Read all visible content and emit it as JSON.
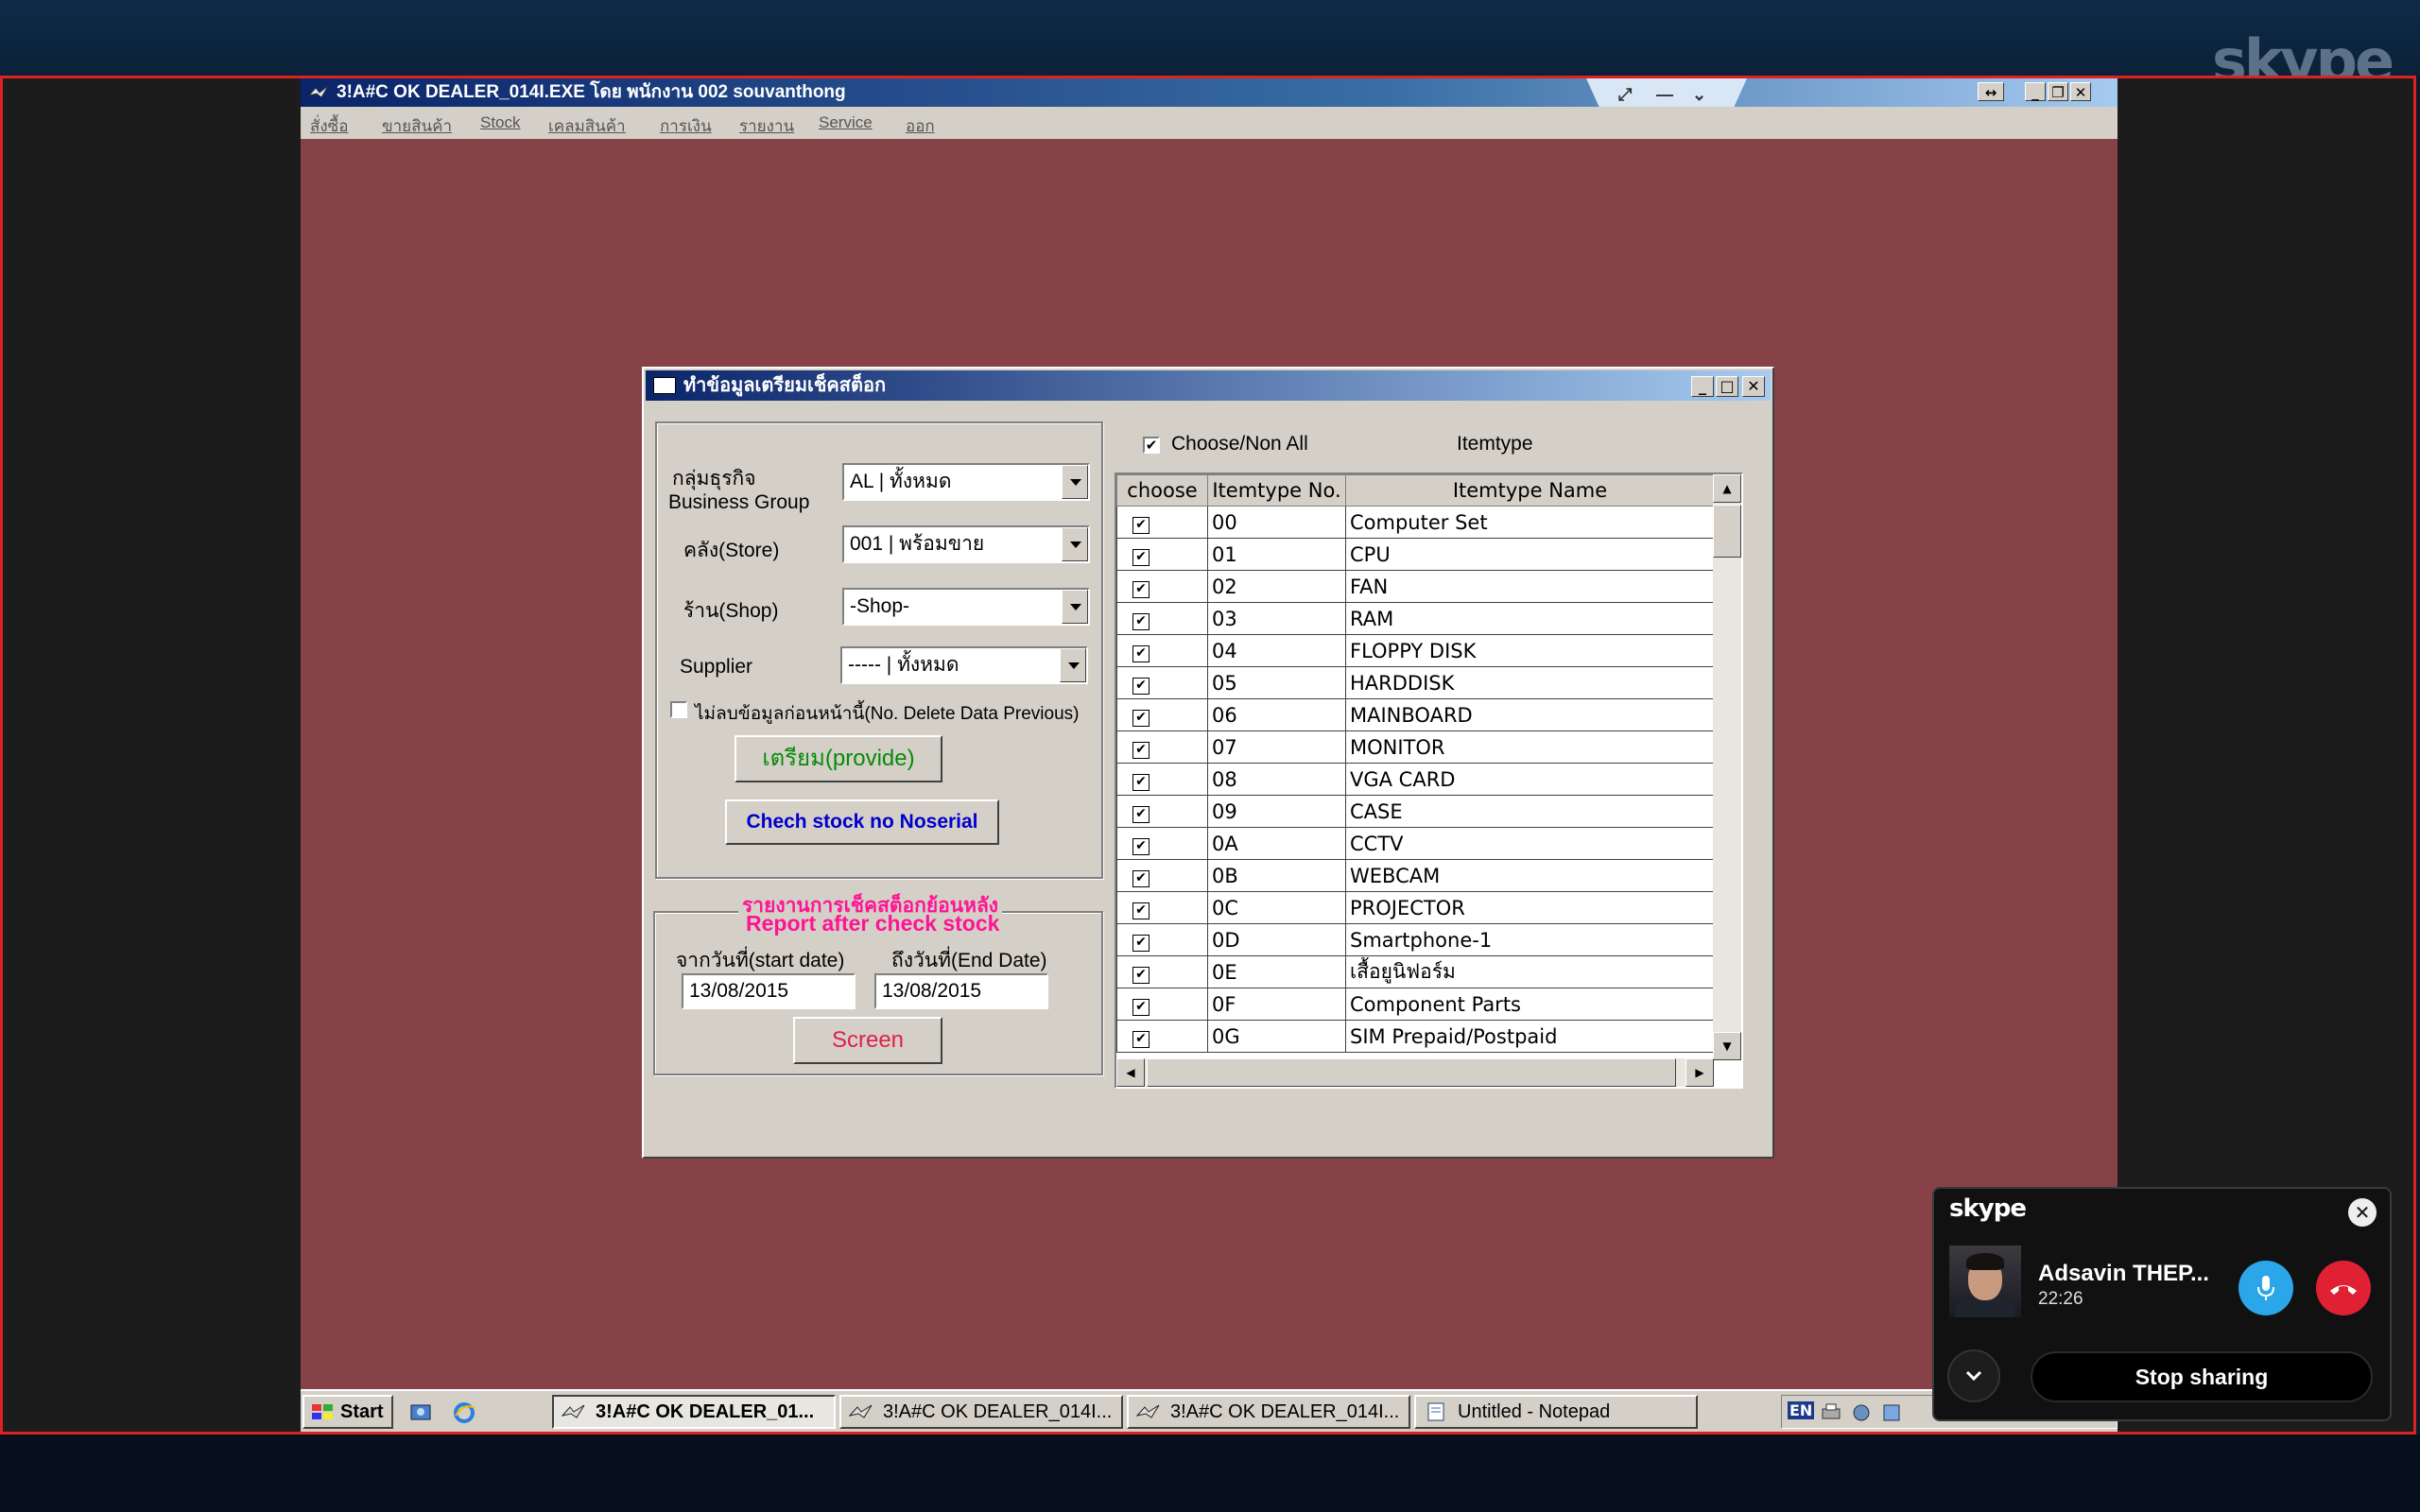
{
  "app": {
    "title": "3!A#C OK DEALER_014I.EXE โดย พนักงาน 002 souvanthong",
    "menu": [
      "สั่งซื้อ",
      "ขายสินค้า",
      "Stock",
      "เคลมสินค้า",
      "การเงิน",
      "รายงาน",
      "Service",
      "ออก"
    ]
  },
  "dialog": {
    "title": "ทำข้อมูลเตรียมเช็คสต็อก",
    "business_group_label": "กลุ่มธุรกิจ",
    "business_group_label_en": "Business Group",
    "business_group_value": "AL | ทั้งหมด",
    "store_label": "คลัง(Store)",
    "store_value": "001 | พร้อมขาย",
    "shop_label": "ร้าน(Shop)",
    "shop_value": "-Shop-",
    "supplier_label": "Supplier",
    "supplier_value": "----- | ทั้งหมด",
    "no_delete_label": "ไม่ลบข้อมูลก่อนหน้านี้(No. Delete Data Previous)",
    "provide_button": "เตรียม(provide)",
    "check_nosn_button": "Chech stock no  Noserial",
    "report_title_th": "รายงานการเช็คสต็อกย้อนหลัง",
    "report_title_en": "Report after check stock",
    "start_date_label": "จากวันที่(start date)",
    "end_date_label": "ถึงวันที่(End Date)",
    "start_date": "13/08/2015",
    "end_date": "13/08/2015",
    "screen_button": "Screen",
    "choose_all_label": "Choose/Non All",
    "itemtype_heading": "Itemtype",
    "grid": {
      "headers": [
        "choose",
        "Itemtype No.",
        "Itemtype Name"
      ],
      "rows": [
        {
          "no": "00",
          "name": "Computer Set"
        },
        {
          "no": "01",
          "name": "CPU"
        },
        {
          "no": "02",
          "name": "FAN"
        },
        {
          "no": "03",
          "name": "RAM"
        },
        {
          "no": "04",
          "name": "FLOPPY DISK"
        },
        {
          "no": "05",
          "name": "HARDDISK"
        },
        {
          "no": "06",
          "name": "MAINBOARD"
        },
        {
          "no": "07",
          "name": "MONITOR"
        },
        {
          "no": "08",
          "name": "VGA CARD"
        },
        {
          "no": "09",
          "name": "CASE"
        },
        {
          "no": "0A",
          "name": "CCTV"
        },
        {
          "no": "0B",
          "name": "WEBCAM"
        },
        {
          "no": "0C",
          "name": "PROJECTOR"
        },
        {
          "no": "0D",
          "name": "Smartphone-1"
        },
        {
          "no": "0E",
          "name": "เสื้อยูนิฟอร์ม"
        },
        {
          "no": "0F",
          "name": "Component Parts"
        },
        {
          "no": "0G",
          "name": "SIM Prepaid/Postpaid"
        }
      ]
    }
  },
  "taskbar": {
    "start": "Start",
    "tasks": [
      "3!A#C OK DEALER_01...",
      "3!A#C OK DEALER_014I...",
      "3!A#C OK DEALER_014I...",
      "Untitled - Notepad"
    ],
    "lang": "EN"
  },
  "skype": {
    "watermark": "skype",
    "logo": "skype",
    "caller_name": "Adsavin THEP...",
    "call_time": "22:26",
    "stop_sharing": "Stop sharing"
  },
  "colors": {
    "desktop": "#864246",
    "share_border": "#dd2222",
    "mic": "#2ba6e8",
    "end_call": "#e02033",
    "provide_text": "#0a8a0a",
    "noserial_text": "#0000cc",
    "report_text": "#ff1493",
    "screen_text": "#e0204a"
  }
}
